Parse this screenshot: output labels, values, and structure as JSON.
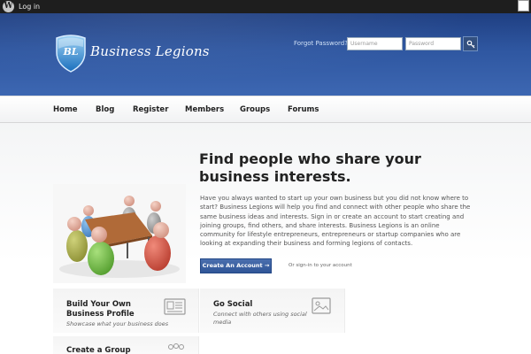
{
  "adminbar": {
    "login_label": "Log in",
    "wp_logo_icon": "wordpress-icon",
    "search_icon": "search-field"
  },
  "header": {
    "logo_text": "Business Legions",
    "logo_badge": "BL",
    "forgot_password": "Forgot Password?",
    "username_placeholder": "Username",
    "password_placeholder": "Password",
    "login_button_icon": "key-icon"
  },
  "nav": {
    "items": [
      {
        "label": "Home"
      },
      {
        "label": "Blog"
      },
      {
        "label": "Register"
      },
      {
        "label": "Members"
      },
      {
        "label": "Groups"
      },
      {
        "label": "Forums"
      }
    ]
  },
  "main": {
    "headline": "Find people who share your business interests.",
    "intro": "Have you always wanted to start up your own business but you did not know where to start? Business Legions will help you find and connect with other people who share the same business ideas and interests. Sign in or create an account to start creating and joining groups, find others, and share interests. Business Legions is an online community for lifestyle entrepreneurs, entrepreneurs or startup companies who are looking at expanding their business and forming legions of contacts.",
    "cta_label": "Create An Account →",
    "signin_text": "Or sign-in to your account"
  },
  "features": [
    {
      "title": "Build Your Own Business Profile",
      "desc": "Showcase what your business does",
      "icon": "profile-card-icon"
    },
    {
      "title": "Go Social",
      "desc": "Connect with others using social media",
      "icon": "image-icon"
    },
    {
      "title": "Create a Group",
      "desc": "",
      "icon": "group-icon"
    }
  ],
  "colors": {
    "header": "#2f57a1",
    "adminbar": "#1e1e1e",
    "cta": "#3a5f9f"
  }
}
